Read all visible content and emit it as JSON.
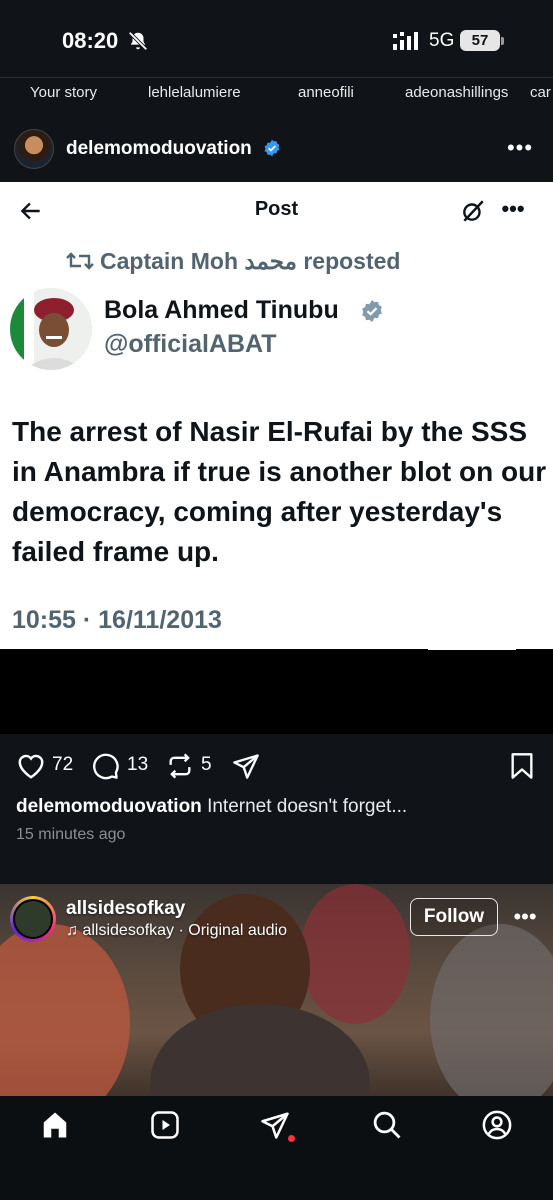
{
  "status_bar": {
    "time": "08:20",
    "network": "5G",
    "battery": "57"
  },
  "stories": [
    "Your story",
    "lehlelalumiere",
    "anneofili",
    "adeonashillings",
    "car"
  ],
  "post": {
    "username": "delemomoduovation",
    "likes": "72",
    "comments": "13",
    "reposts": "5",
    "caption_user": "delemomoduovation",
    "caption_text": "Internet doesn't forget...",
    "time_ago": "15 minutes ago"
  },
  "tweet": {
    "title": "Post",
    "repost_line": "Captain Moh محمد reposted",
    "name": "Bola Ahmed Tinubu",
    "handle": "@officialABAT",
    "text": "The arrest of Nasir El-Rufai by the SSS in Anambra if true is another blot on our democracy, coming after yesterday's failed frame up.",
    "timestamp": "10:55 · 16/11/2013"
  },
  "reel": {
    "username": "allsidesofkay",
    "audio": "allsidesofkay · Original audio",
    "follow_label": "Follow"
  },
  "colors": {
    "accent_verified": "#3897f0",
    "background": "#101418",
    "notification_dot": "#ff3040"
  },
  "icons": [
    "bell-off-icon",
    "signal-icon",
    "verified-icon",
    "heart-icon",
    "comment-icon",
    "repost-icon",
    "share-icon",
    "bookmark-icon",
    "home-icon",
    "reels-icon",
    "messages-icon",
    "search-icon",
    "profile-icon"
  ]
}
